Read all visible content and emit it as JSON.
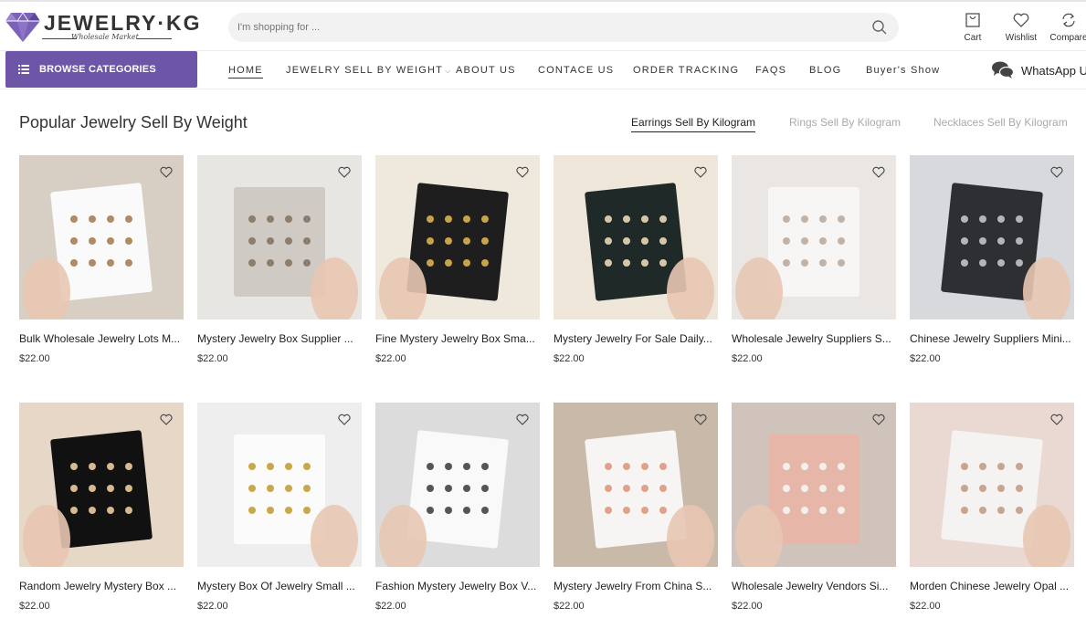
{
  "header": {
    "logo_text": "JEWELRY·KG",
    "logo_tagline": "Wholesale Market",
    "search_placeholder": "I'm shopping for ...",
    "icons": [
      {
        "name": "cart-icon",
        "label": "Cart"
      },
      {
        "name": "wishlist-icon",
        "label": "Wishlist"
      },
      {
        "name": "compare-icon",
        "label": "Compare"
      }
    ]
  },
  "nav": {
    "browse_label": "BROWSE CATEGORIES",
    "items": [
      "HOME",
      "JEWELRY SELL BY WEIGHT",
      "ABOUT US",
      "CONTACE US",
      "ORDER TRACKING",
      "FAQS",
      "BLOG",
      "Buyer's Show"
    ],
    "active_item": "HOME",
    "whatsapp_label": "WhatsApp Us"
  },
  "section": {
    "title": "Popular Jewelry Sell By Weight",
    "tabs": [
      "Earrings Sell By Kilogram",
      "Rings Sell By Kilogram",
      "Necklaces Sell By Kilogram"
    ],
    "active_tab": "Earrings Sell By Kilogram"
  },
  "products": [
    {
      "name": "Bulk Wholesale Jewelry Lots M...",
      "price": "$22.00"
    },
    {
      "name": "Mystery Jewelry Box Supplier ...",
      "price": "$22.00"
    },
    {
      "name": "Fine Mystery Jewelry Box Sma...",
      "price": "$22.00"
    },
    {
      "name": "Mystery Jewelry For Sale Daily...",
      "price": "$22.00"
    },
    {
      "name": "Wholesale Jewelry Suppliers S...",
      "price": "$22.00"
    },
    {
      "name": "Chinese Jewelry Suppliers Mini...",
      "price": "$22.00"
    },
    {
      "name": "Random Jewelry Mystery Box ...",
      "price": "$22.00"
    },
    {
      "name": "Mystery Box Of Jewelry Small ...",
      "price": "$22.00"
    },
    {
      "name": "Fashion Mystery Jewelry Box V...",
      "price": "$22.00"
    },
    {
      "name": "Mystery Jewelry From China S...",
      "price": "$22.00"
    },
    {
      "name": "Wholesale Jewelry Vendors Si...",
      "price": "$22.00"
    },
    {
      "name": "Morden Chinese Jewelry Opal ...",
      "price": "$22.00"
    }
  ],
  "colors": {
    "accent": "#6d55a8",
    "logo_diamond": "#7b62b8"
  }
}
